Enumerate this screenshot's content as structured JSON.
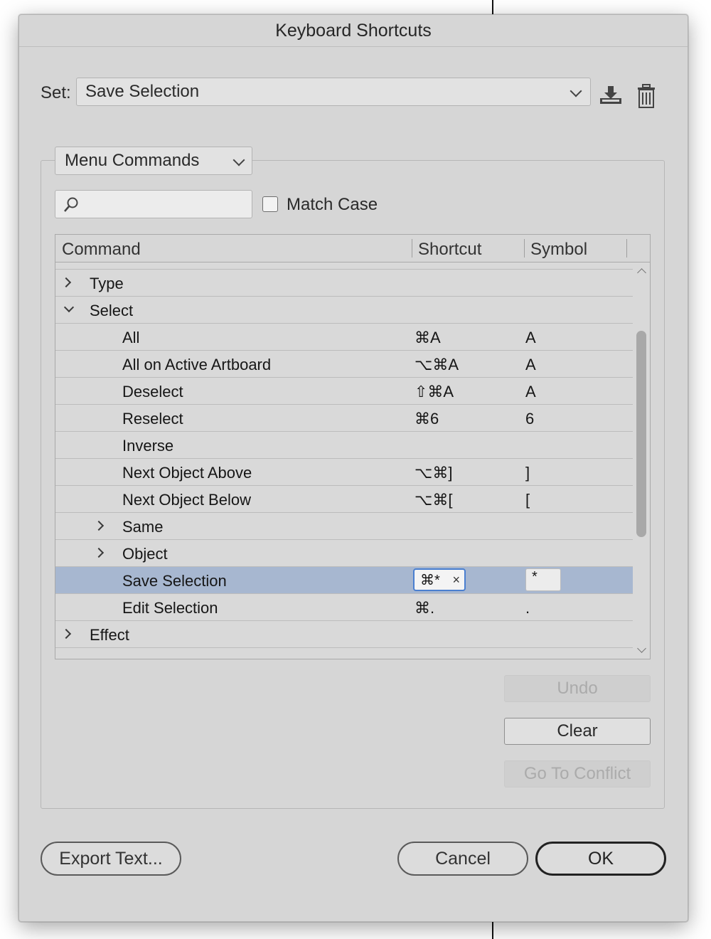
{
  "dialog": {
    "title": "Keyboard Shortcuts"
  },
  "set": {
    "label": "Set:",
    "value": "Save Selection"
  },
  "category": {
    "value": "Menu Commands"
  },
  "search": {
    "value": "",
    "placeholder": ""
  },
  "match_case": {
    "label": "Match Case",
    "checked": false
  },
  "table": {
    "headers": {
      "command": "Command",
      "shortcut": "Shortcut",
      "symbol": "Symbol"
    },
    "rows": [
      {
        "command": "Type",
        "shortcut": "",
        "symbol": "",
        "level": 0,
        "expander": "closed"
      },
      {
        "command": "Select",
        "shortcut": "",
        "symbol": "",
        "level": 0,
        "expander": "open"
      },
      {
        "command": "All",
        "shortcut": "⌘A",
        "symbol": "A",
        "level": 1
      },
      {
        "command": "All on Active Artboard",
        "shortcut": "⌥⌘A",
        "symbol": "A",
        "level": 1
      },
      {
        "command": "Deselect",
        "shortcut": "⇧⌘A",
        "symbol": "A",
        "level": 1
      },
      {
        "command": "Reselect",
        "shortcut": "⌘6",
        "symbol": "6",
        "level": 1
      },
      {
        "command": "Inverse",
        "shortcut": "",
        "symbol": "",
        "level": 1
      },
      {
        "command": "Next Object Above",
        "shortcut": "⌥⌘]",
        "symbol": "]",
        "level": 1
      },
      {
        "command": "Next Object Below",
        "shortcut": "⌥⌘[",
        "symbol": "[",
        "level": 1
      },
      {
        "command": "Same",
        "shortcut": "",
        "symbol": "",
        "level": 1,
        "expander": "closed"
      },
      {
        "command": "Object",
        "shortcut": "",
        "symbol": "",
        "level": 1,
        "expander": "closed"
      },
      {
        "command": "Save Selection",
        "shortcut": "⌘*",
        "symbol": "*",
        "level": 1,
        "selected": true
      },
      {
        "command": "Edit Selection",
        "shortcut": "⌘.",
        "symbol": ".",
        "level": 1
      },
      {
        "command": "Effect",
        "shortcut": "",
        "symbol": "",
        "level": 0,
        "expander": "closed"
      }
    ]
  },
  "buttons": {
    "undo": "Undo",
    "clear": "Clear",
    "go_to_conflict": "Go To Conflict",
    "export_text": "Export Text...",
    "cancel": "Cancel",
    "ok": "OK"
  },
  "icons": {
    "save_set": "download-icon",
    "delete_set": "trash-icon",
    "search": "search-icon",
    "set_dropdown": "chevron-down-icon"
  },
  "colors": {
    "dialog_bg": "#d6d6d6",
    "selected_row": "#a7b7d0",
    "focus_ring": "#4a7fd0"
  }
}
